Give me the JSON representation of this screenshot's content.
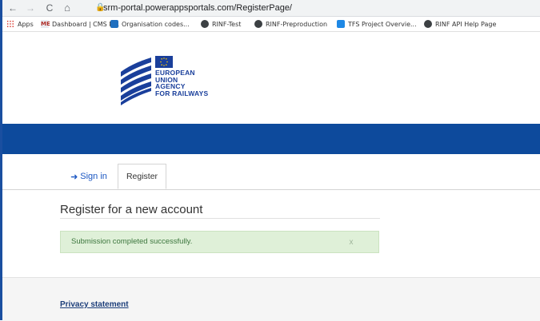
{
  "browser": {
    "url": "srm-portal.powerappsportals.com/RegisterPage/",
    "nav": {
      "back": "←",
      "forward": "→",
      "reload": "C",
      "home": "⌂"
    },
    "bookmarks": [
      {
        "label": "Apps",
        "icon": "apps-grid-icon"
      },
      {
        "label": "Dashboard | CMS R...",
        "icon": "dashboard-favicon"
      },
      {
        "label": "Organisation codes...",
        "icon": "sharepoint-favicon"
      },
      {
        "label": "RINF-Test",
        "icon": "globe-icon"
      },
      {
        "label": "RINF-Preproduction",
        "icon": "globe-icon"
      },
      {
        "label": "TFS Project Overvie...",
        "icon": "tfs-favicon"
      },
      {
        "label": "RINF API Help Page",
        "icon": "globe-icon"
      }
    ]
  },
  "logo": {
    "lines": [
      "EUROPEAN",
      "UNION",
      "AGENCY",
      "FOR RAILWAYS"
    ]
  },
  "tabs": {
    "signin": "Sign in",
    "register": "Register"
  },
  "main": {
    "title": "Register for a new account",
    "alert": {
      "message": "Submission completed successfully.",
      "close": "x"
    }
  },
  "footer": {
    "privacy": "Privacy statement"
  },
  "colors": {
    "brand_blue": "#0d4a9c",
    "alert_bg": "#dff0d8",
    "alert_text": "#3c763d"
  }
}
